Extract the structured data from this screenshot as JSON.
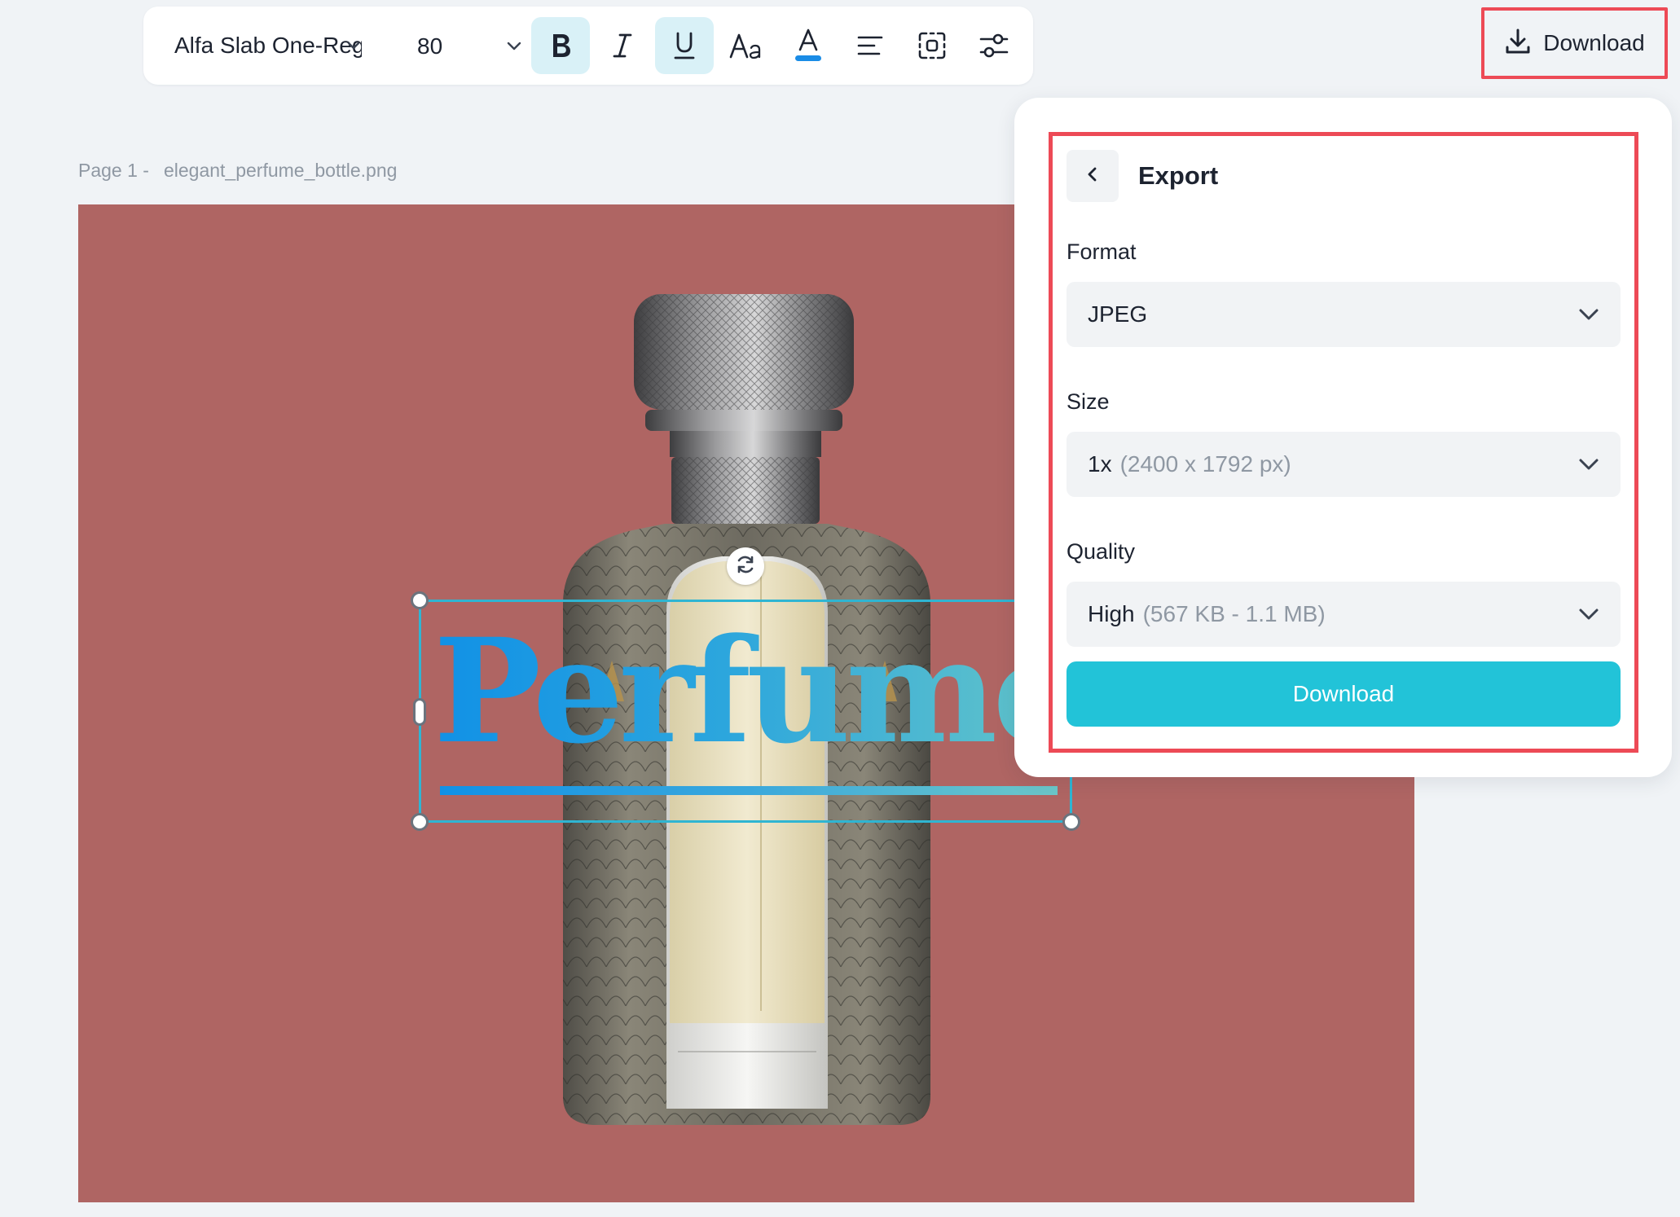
{
  "toolbar": {
    "font_family": "Alfa Slab One-Regular",
    "font_size": "80",
    "bold_active": true,
    "underline_active": true,
    "text_color": "#1a8ce6"
  },
  "header": {
    "download_label": "Download"
  },
  "page": {
    "label": "Page 1 -",
    "filename": "elegant_perfume_bottle.png"
  },
  "canvas": {
    "background_color": "#af6563",
    "text_layer": "Perfume"
  },
  "export": {
    "title": "Export",
    "format_label": "Format",
    "format_value": "JPEG",
    "size_label": "Size",
    "size_value": "1x",
    "size_hint": "(2400 x 1792 px)",
    "quality_label": "Quality",
    "quality_value": "High",
    "quality_hint": "(567 KB - 1.1 MB)",
    "download_label": "Download"
  },
  "colors": {
    "accent": "#22c3d8",
    "highlight": "#ed4a56",
    "selection": "#2fb5d2"
  }
}
